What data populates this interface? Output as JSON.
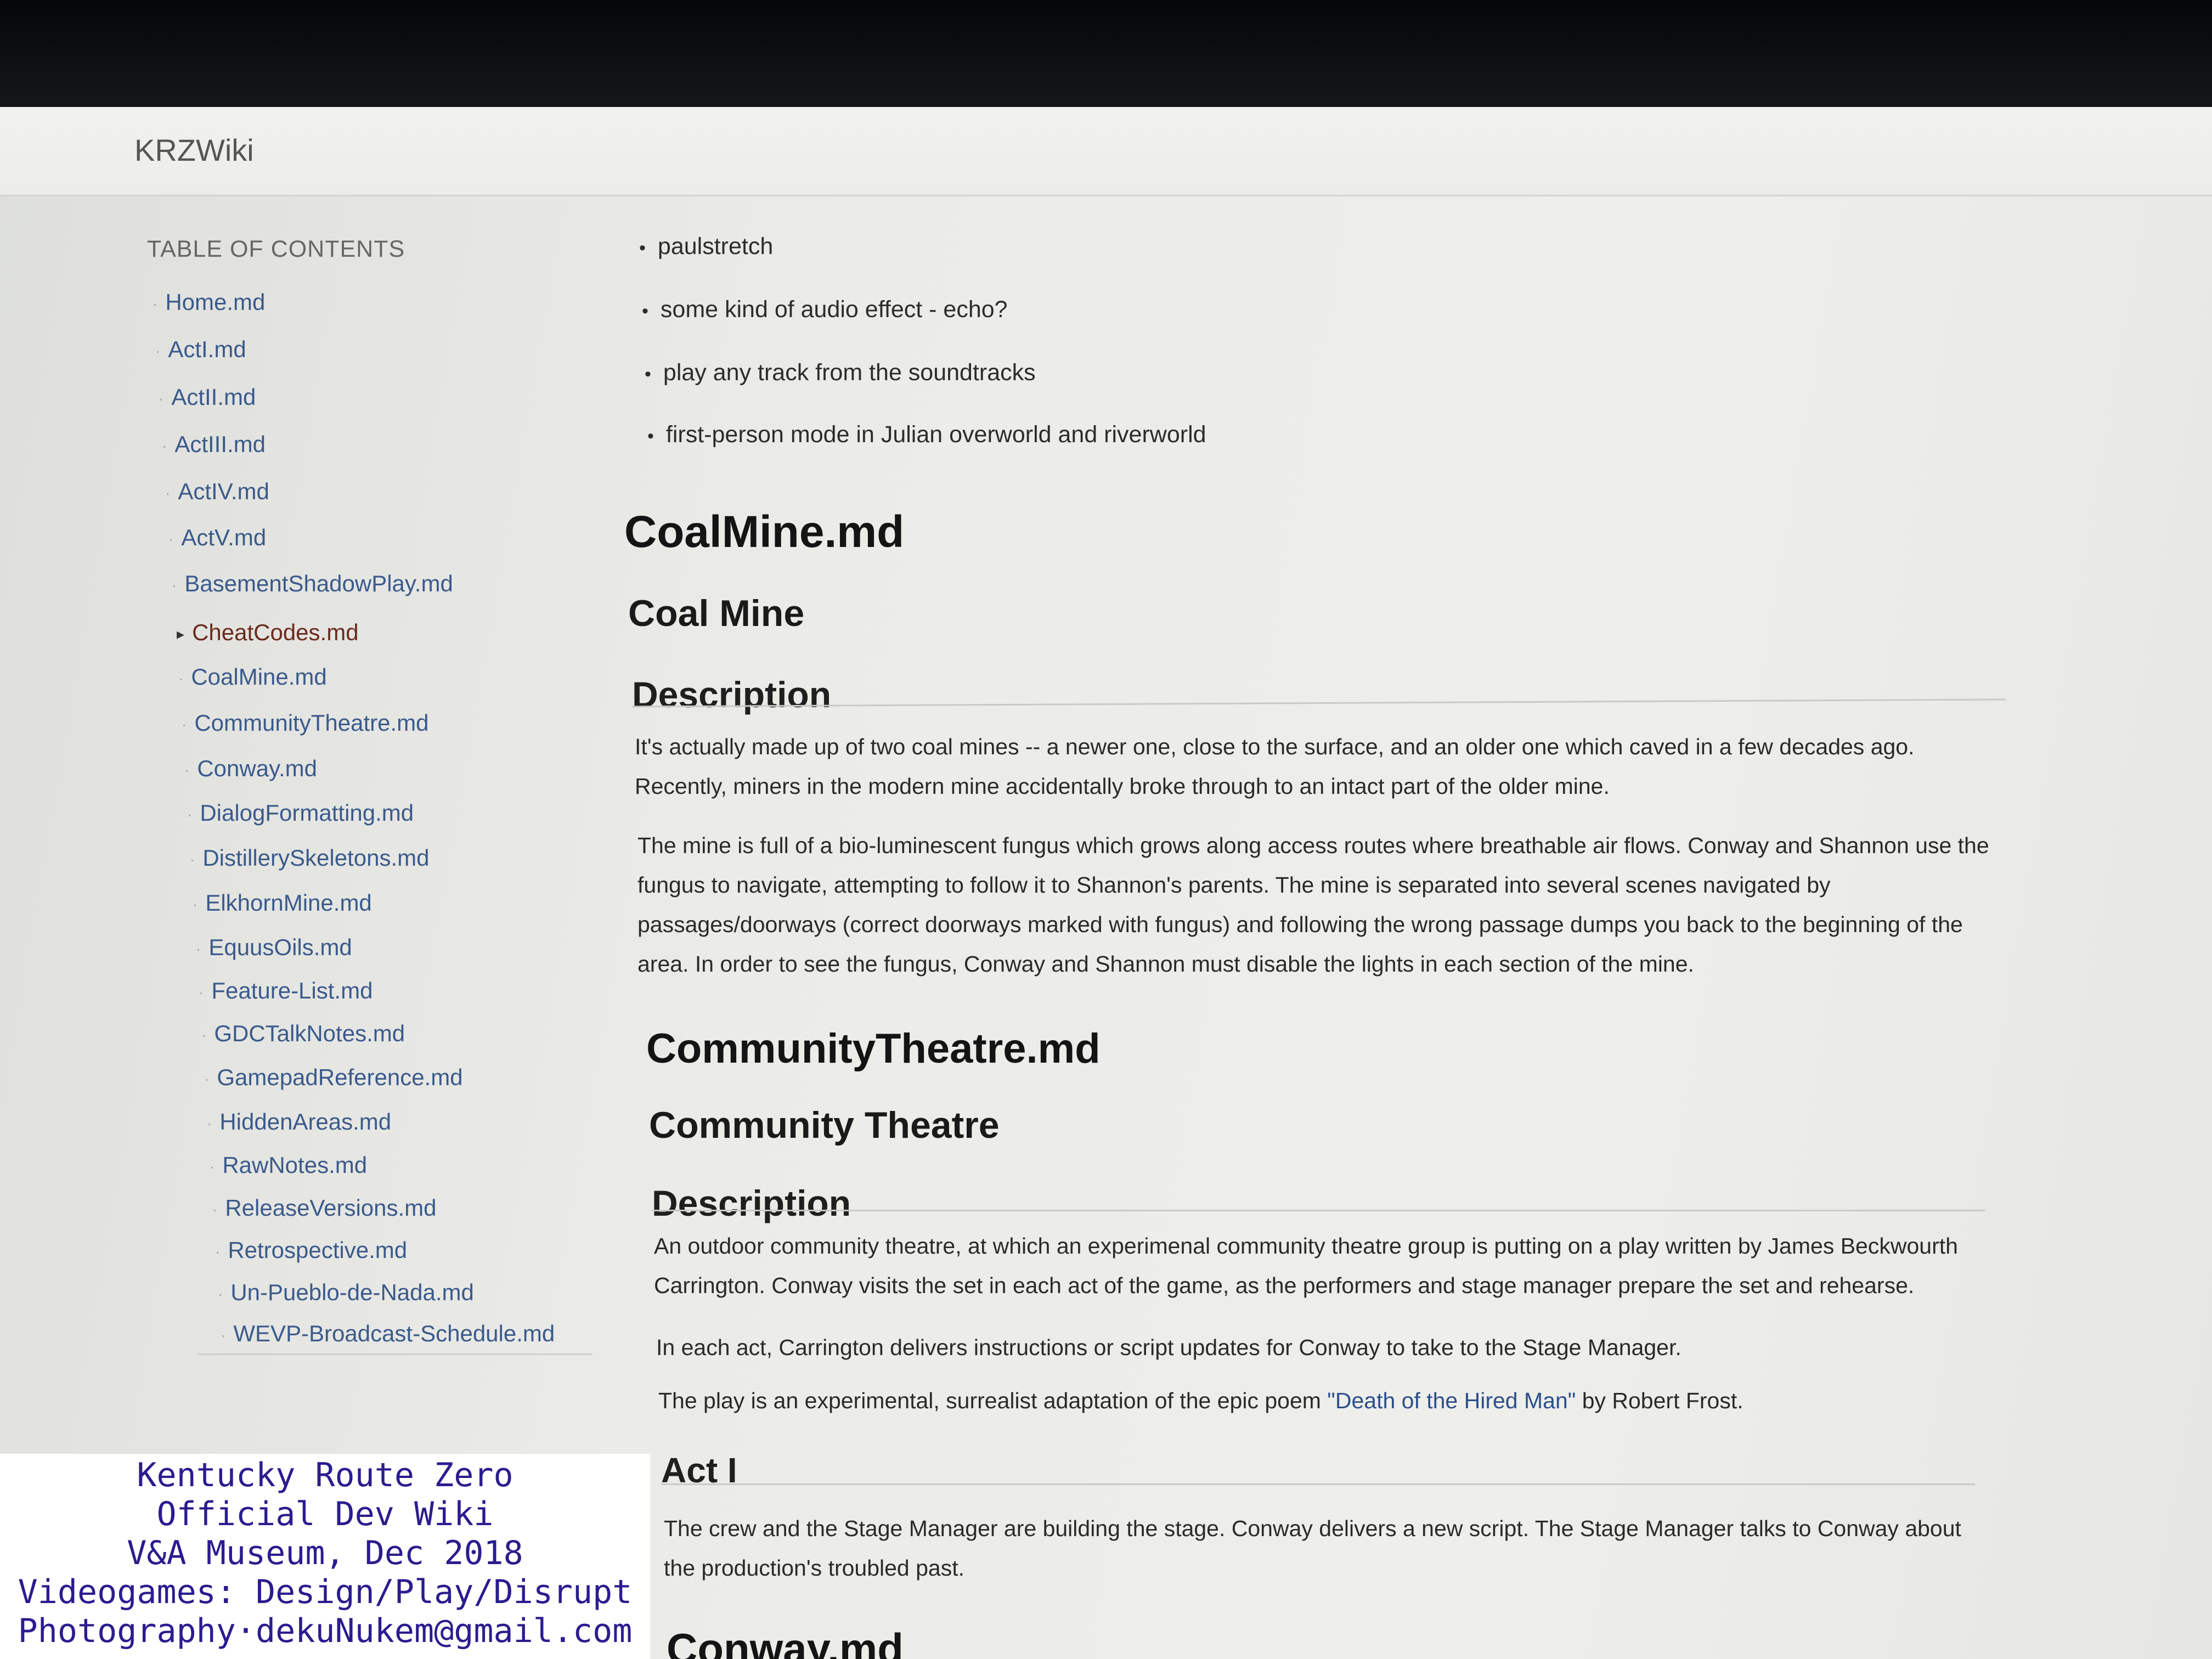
{
  "app": {
    "brand": "KRZWiki"
  },
  "sidebar": {
    "title": "TABLE OF CONTENTS",
    "current": "CheatCodes.md",
    "items": [
      "Home.md",
      "ActI.md",
      "ActII.md",
      "ActIII.md",
      "ActIV.md",
      "ActV.md",
      "BasementShadowPlay.md",
      "CheatCodes.md",
      "CoalMine.md",
      "CommunityTheatre.md",
      "Conway.md",
      "DialogFormatting.md",
      "DistillerySkeletons.md",
      "ElkhornMine.md",
      "EquusOils.md",
      "Feature-List.md",
      "GDCTalkNotes.md",
      "GamepadReference.md",
      "HiddenAreas.md",
      "RawNotes.md",
      "ReleaseVersions.md",
      "Retrospective.md",
      "Un-Pueblo-de-Nada.md",
      "WEVP-Broadcast-Schedule.md"
    ]
  },
  "main": {
    "bullets": [
      "paulstretch",
      "some kind of audio effect - echo?",
      "play any track from the soundtracks",
      "first-person mode in Julian overworld and riverworld"
    ],
    "coalmine": {
      "file": "CoalMine.md",
      "title": "Coal Mine",
      "section": "Description",
      "p1": "It's actually made up of two coal mines -- a newer one, close to the surface, and an older one which caved in a few decades ago. Recently, miners in the modern mine accidentally broke through to an intact part of the older mine.",
      "p2": "The mine is full of a bio-luminescent fungus which grows along access routes where breathable air flows. Conway and Shannon use the fungus to navigate, attempting to follow it to Shannon's parents. The mine is separated into several scenes navigated by passages/doorways (correct doorways marked with fungus) and following the wrong passage dumps you back to the beginning of the area. In order to see the fungus, Conway and Shannon must disable the lights in each section of the mine."
    },
    "theatre": {
      "file": "CommunityTheatre.md",
      "title": "Community Theatre",
      "section": "Description",
      "p1": "An outdoor community theatre, at which an experimenal community theatre group is putting on a play written by James Beckwourth Carrington. Conway visits the set in each act of the game, as the performers and stage manager prepare the set and rehearse.",
      "p2": "In each act, Carrington delivers instructions or script updates for Conway to take to the Stage Manager.",
      "p3_pre": "The play is an experimental, surrealist adaptation of the epic poem ",
      "p3_link": "\"Death of the Hired Man\"",
      "p3_post": " by Robert Frost.",
      "act_heading": "Act I",
      "act_text": "The crew and the Stage Manager are building the stage. Conway delivers a new script. The Stage Manager talks to Conway about the production's troubled past."
    },
    "next_file": "Conway.md"
  },
  "watermark": {
    "lines": [
      "Kentucky Route Zero",
      "Official Dev Wiki",
      "V&A Museum, Dec 2018",
      "Videogames: Design/Play/Disrupt",
      "Photography·dekuNukem@gmail.com"
    ]
  }
}
